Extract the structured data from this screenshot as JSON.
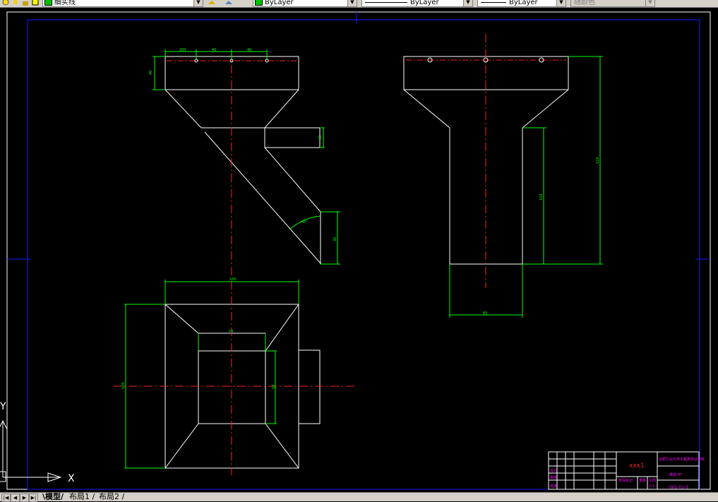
{
  "toolbar": {
    "layer_name": "细实线",
    "color_value": "ByLayer",
    "linetype_value": "ByLayer",
    "lineweight_value": "ByLayer",
    "plotstyle_value": "随颜色"
  },
  "dimensions": {
    "front_top_1": "200",
    "front_top_2": "40",
    "front_top_3": "40",
    "front_left": "40",
    "front_pipe": "60",
    "front_angle": "45°",
    "front_right": "40",
    "side_height": "120",
    "side_inner": "104",
    "side_bottom": "80",
    "plan_top": "100",
    "plan_inner_w": "70",
    "plan_left": "100",
    "plan_inner_h": "50"
  },
  "title_block": {
    "drawing_name": "xxx1",
    "school": "合肥工业大学工程类专业学院",
    "material": "铸铁 HT",
    "number": "001 01-3",
    "scale": "1:1",
    "designer": "设计",
    "checker": "审核",
    "approve": "批准",
    "stage": "阶段标记",
    "weight": "重量",
    "ratio": "比例"
  },
  "ucs": {
    "x_label": "X",
    "y_label": "Y"
  },
  "tabs": {
    "model": "模型",
    "layout1": "布局1",
    "layout2": "布局2"
  }
}
